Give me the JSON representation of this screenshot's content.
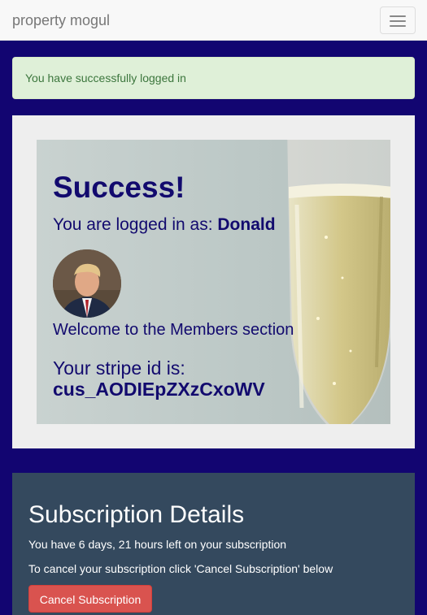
{
  "navbar": {
    "brand": "property mogul",
    "toggle_icon": "hamburger-icon"
  },
  "alert": {
    "message": "You have successfully logged in"
  },
  "hero": {
    "heading": "Success!",
    "logged_in_prefix": "You are logged in as: ",
    "username": "Donald",
    "welcome": "Welcome to the Members section",
    "stripe_label": "Your stripe id is:",
    "stripe_id": "cus_AODIEpZXzCxoWV"
  },
  "subscription": {
    "title": "Subscription Details",
    "time_left": "You have 6 days, 21 hours left on your subscription",
    "cancel_hint": "To cancel your subscription click 'Cancel Subscription' below",
    "cancel_button": "Cancel Subscription"
  },
  "colors": {
    "page_bg": "#120571",
    "alert_bg": "#dff0d8",
    "hero_text": "#120a6e",
    "subscription_bg": "#34495e",
    "cancel_button": "#d9534f"
  }
}
